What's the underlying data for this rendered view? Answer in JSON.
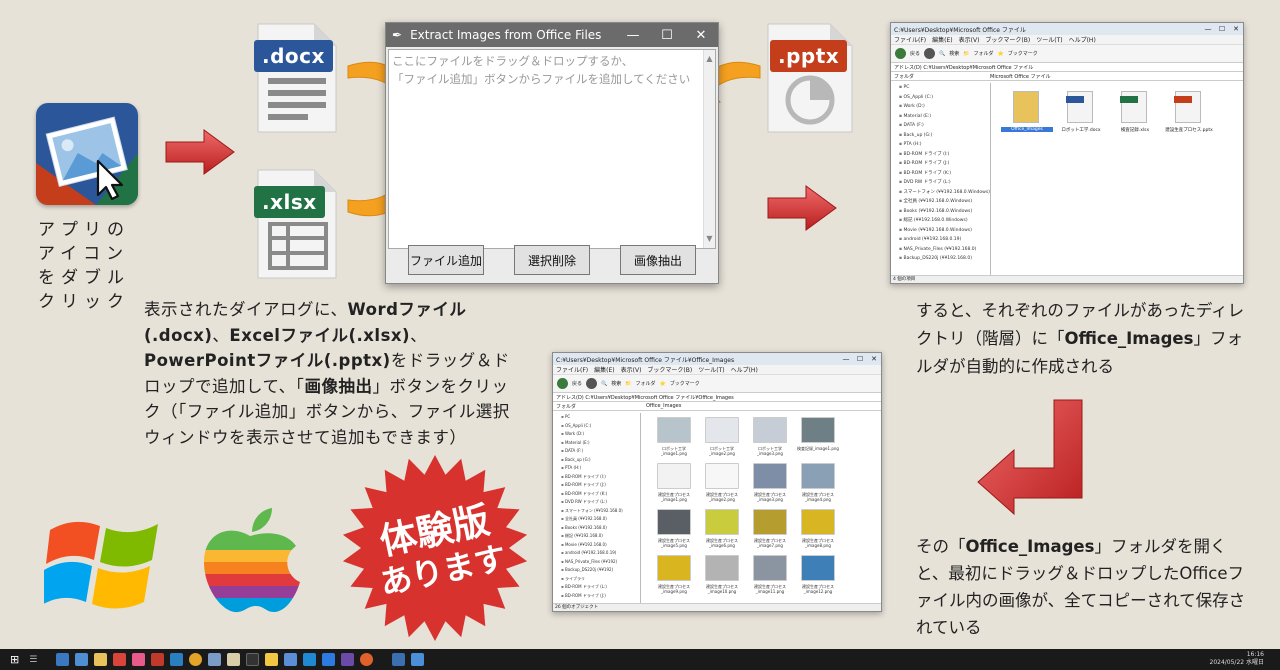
{
  "app_caption": "アプリのアイコンをダブルクリック",
  "file_labels": {
    "docx": ".docx",
    "xlsx": ".xlsx",
    "pptx": ".pptx"
  },
  "dialog": {
    "title": "Extract Images from Office Files",
    "window_controls": [
      "—",
      "☐",
      "✕"
    ],
    "instruction_line1": "ここにファイルをドラッグ＆ドロップするか、",
    "instruction_line2": "「ファイル追加」ボタンからファイルを追加してください",
    "buttons": {
      "add": "ファイル追加",
      "remove": "選択削除",
      "extract": "画像抽出"
    }
  },
  "main_text": {
    "p1": "表示されたダイアログに、",
    "b1": "Wordファイル(.docx)",
    "p2": "、",
    "b2": "Excelファイル(.xlsx)",
    "p3": "、",
    "b3": "PowerPointファイル(.pptx)",
    "p4": "をドラッグ＆ドロップで追加して、「",
    "b4": "画像抽出",
    "p5": "」ボタンをクリック（「ファイル追加」ボタンから、ファイル選択ウィンドウを表示させて追加もできます）"
  },
  "right_text1": {
    "p1": "すると、それぞれのファイルがあったディレクトリ（階層）に「",
    "b1": "Office_Images",
    "p2": "」フォルダが自動的に作成される"
  },
  "right_text2": {
    "p1": "その「",
    "b1": "Office_Images",
    "p2": "」フォルダを開くと、最初にドラッグ＆ドロップしたOfficeファイル内の画像が、全てコピーされて保存されている"
  },
  "badge": {
    "line1": "体験版",
    "line2": "あります"
  },
  "explorer1": {
    "title": "C:¥Users¥Desktop¥Microsoft Office ファイル",
    "menu": [
      "ファイル(F)",
      "編集(E)",
      "表示(V)",
      "ブックマーク(B)",
      "ツール(T)",
      "ヘルプ(H)"
    ],
    "toolbar": [
      "戻る",
      "検索",
      "フォルダ",
      "ブックマーク"
    ],
    "address_label": "アドレス(D)",
    "address": "C:¥Users¥Desktop¥Microsoft Office ファイル",
    "tree_header": "フォルダ",
    "tab": "Microsoft Office ファイル",
    "tree": [
      "PC",
      "OS_Appli (C:)",
      "Work (D:)",
      "Material (E:)",
      "DATA (F:)",
      "Back_up (G:)",
      "PTA (H:)",
      "BD-ROM ドライブ (I:)",
      "BD-ROM ドライブ (J:)",
      "BD-ROM ドライブ (K:)",
      "DVD RW ドライブ (L:)",
      "スマートフォン (¥¥192.168.0.Windows)",
      "全社員 (¥¥192.168.0.Windows)",
      "Books (¥¥192.168.0.Windows)",
      "総記 (¥¥192.168.0.Windows)",
      "Movie (¥¥192.168.0.Windows)",
      "android (¥¥192.168.0.19)",
      "NAS_Private_Files (¥¥192.168.0)",
      "Backup_DS220j (¥¥192.168.0)"
    ],
    "files": [
      {
        "name": "Office_Images",
        "type": "folder"
      },
      {
        "name": "ロボット工学.docx",
        "type": "docx"
      },
      {
        "name": "検査記録.xlsx",
        "type": "xlsx"
      },
      {
        "name": "建設生産プロセス.pptx",
        "type": "pptx"
      }
    ],
    "status": "4 個の項目"
  },
  "explorer2": {
    "title": "C:¥Users¥Desktop¥Microsoft Office ファイル¥Office_Images",
    "menu": [
      "ファイル(F)",
      "編集(E)",
      "表示(V)",
      "ブックマーク(B)",
      "ツール(T)",
      "ヘルプ(H)"
    ],
    "toolbar": [
      "戻る",
      "検索",
      "フォルダ",
      "ブックマーク"
    ],
    "address_label": "アドレス(D)",
    "address": "C:¥Users¥Desktop¥Microsoft Office ファイル¥Office_Images",
    "tree_header": "フォルダ",
    "tab": "Office_Images",
    "tree": [
      "PC",
      "OS_Appli (C:)",
      "Work (D:)",
      "Material (E:)",
      "DATA (F:)",
      "Back_up (G:)",
      "PTA (H:)",
      "BD-ROM ドライブ (I:)",
      "BD-ROM ドライブ (J:)",
      "BD-ROM ドライブ (K:)",
      "DVD RW ドライブ (L:)",
      "スマートフォン (¥¥192.168.0)",
      "全社員 (¥¥192.168.0)",
      "Books (¥¥192.168.0)",
      "総記 (¥¥192.168.0)",
      "Movie (¥¥192.168.0)",
      "android (¥¥192.168.0.19)",
      "NAS_Private_Files (¥¥192)",
      "Backup_DS220j (¥¥192)",
      "ライブラリ",
      "BD-ROM ドライブ (L:)",
      "BD-ROM ドライブ (J:)"
    ],
    "images": [
      {
        "label": "ロボット工学_image1.png",
        "color": "#b8c4cc"
      },
      {
        "label": "ロボット工学_image2.png",
        "color": "#e3e6ea"
      },
      {
        "label": "ロボット工学_image3.png",
        "color": "#c7cdd6"
      },
      {
        "label": "検査記録_image1.png",
        "color": "#6e7f86"
      },
      {
        "label": "建設生産プロセス_image1.png",
        "color": "#f2f2f2"
      },
      {
        "label": "建設生産プロセス_image2.png",
        "color": "#f7f7f7"
      },
      {
        "label": "建設生産プロセス_image3.png",
        "color": "#7d8ea6"
      },
      {
        "label": "建設生産プロセス_image4.png",
        "color": "#8aa0b4"
      },
      {
        "label": "建設生産プロセス_image5.png",
        "color": "#5a5f66"
      },
      {
        "label": "建設生産プロセス_image6.png",
        "color": "#c9cd3d"
      },
      {
        "label": "建設生産プロセス_image7.png",
        "color": "#b59d2f"
      },
      {
        "label": "建設生産プロセス_image8.png",
        "color": "#d8b523"
      },
      {
        "label": "建設生産プロセス_image9.png",
        "color": "#d9b51f"
      },
      {
        "label": "建設生産プロセス_image10.png",
        "color": "#b3b3b3"
      },
      {
        "label": "建設生産プロセス_image11.png",
        "color": "#8b95a1"
      },
      {
        "label": "建設生産プロセス_image12.png",
        "color": "#3e7fb8"
      }
    ],
    "status": "26 個のオブジェクト"
  },
  "taskbar": {
    "time": "16:16",
    "date": "2024/05/22 水曜日"
  },
  "colors": {
    "background": "#e7e2d8",
    "badge_red": "#d8322f",
    "arrow_orange": "#f4a020",
    "arrow_red": "#d02a2a"
  }
}
